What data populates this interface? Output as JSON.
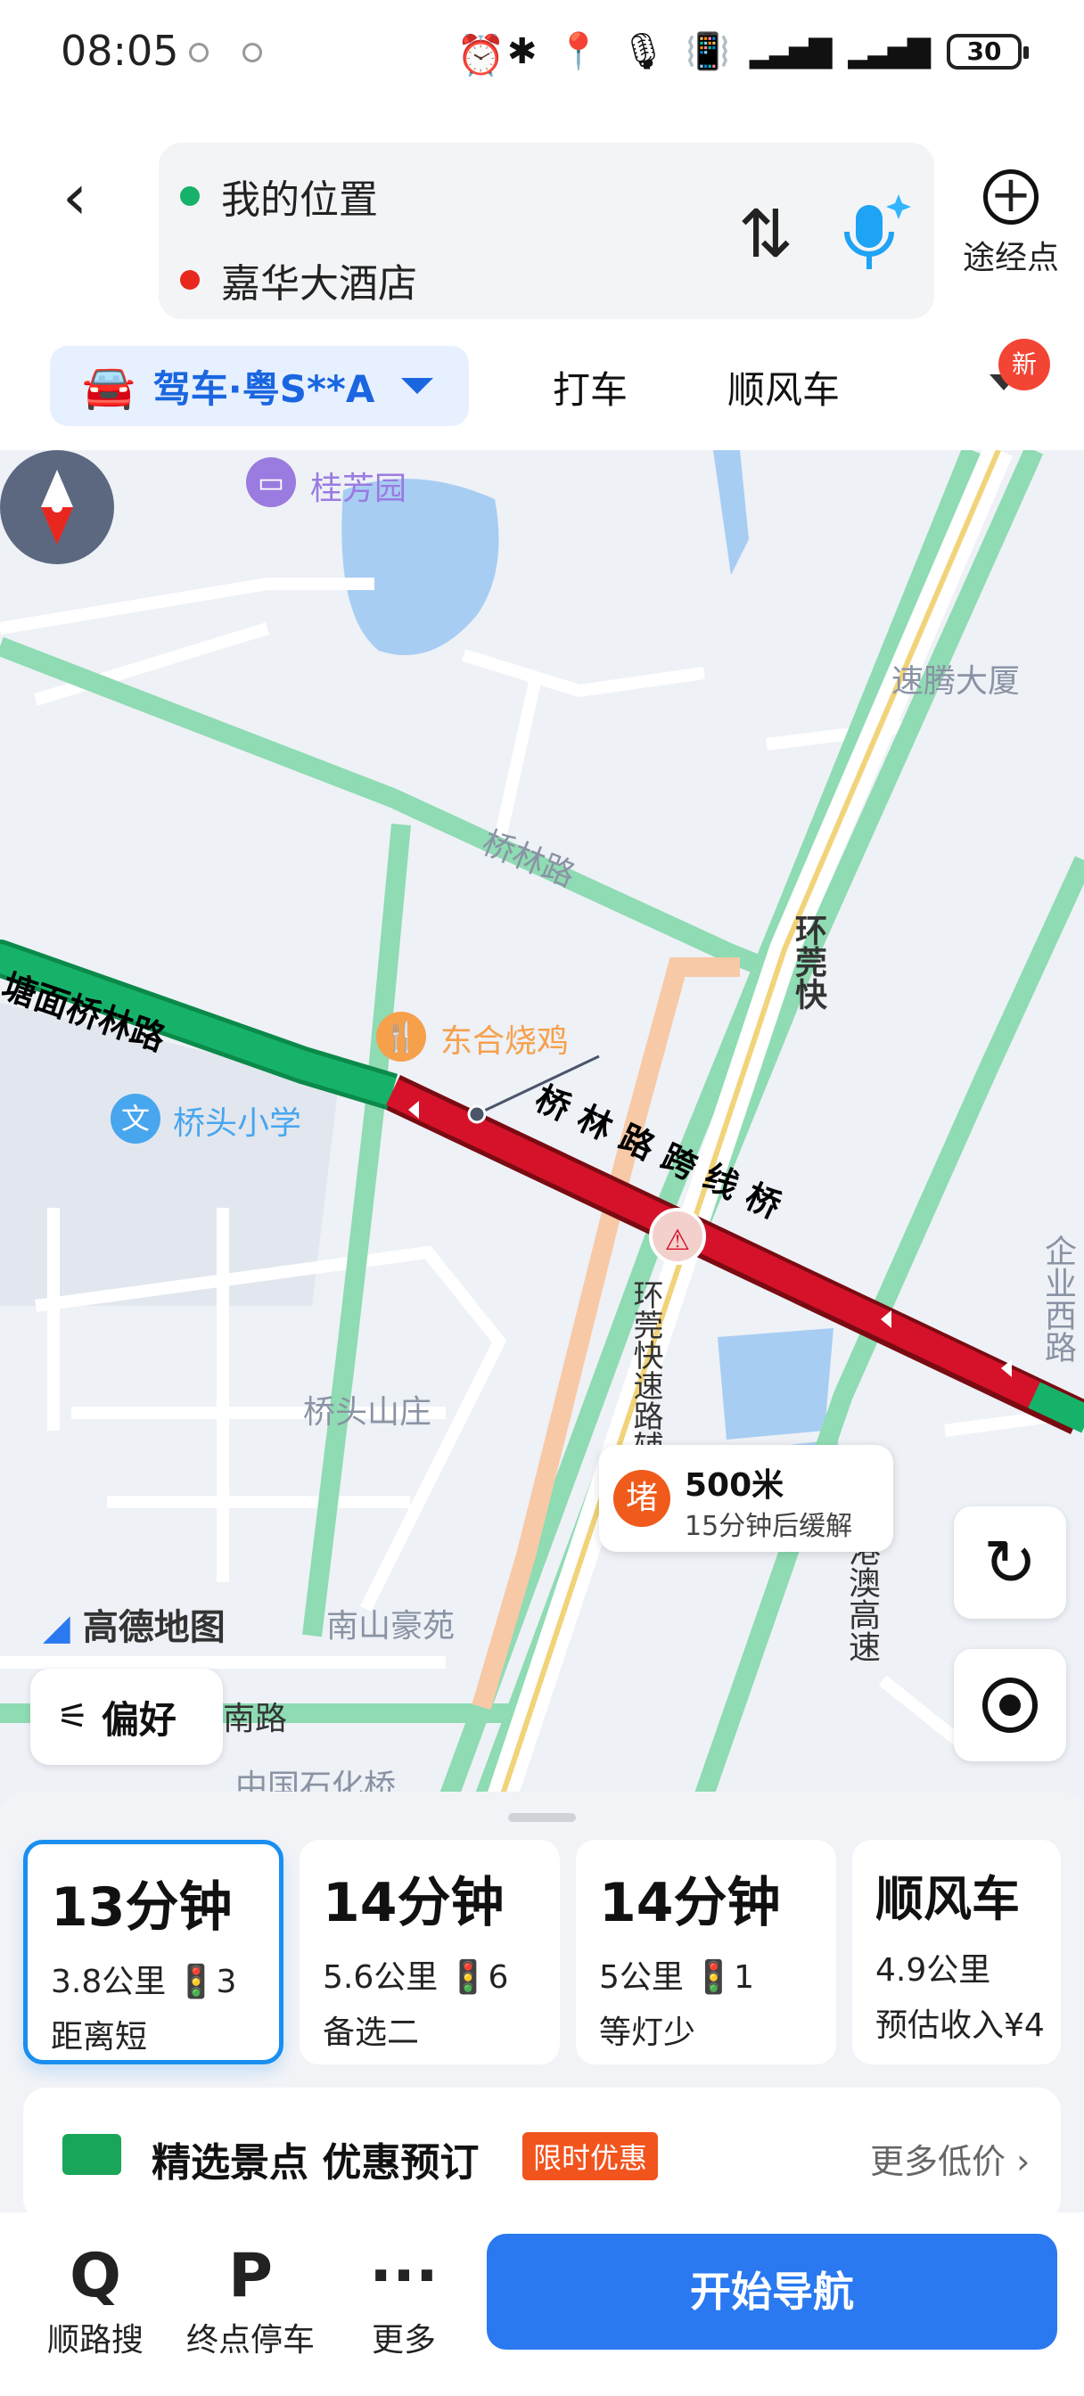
{
  "status_bar": {
    "time": "08:05",
    "battery": "30"
  },
  "route": {
    "origin": "我的位置",
    "destination": "嘉华大酒店",
    "waypoint_label": "途经点"
  },
  "modes": {
    "active": "驾车·粤S**A",
    "tabs": [
      "打车",
      "顺风车"
    ],
    "new_badge": "新"
  },
  "map": {
    "labels": [
      "桂芳园",
      "速腾大厦",
      "桥林路",
      "环莞快",
      "塘面桥林路",
      "东合烧鸡",
      "桥头小学",
      "桥林路跨线桥",
      "环莞快速路辅路",
      "桥头山庄",
      "京港澳高速",
      "南山豪苑",
      "南路",
      "中国石化桥",
      "企业西路"
    ],
    "brand": "高德地图",
    "traffic": {
      "icon": "堵",
      "distance": "500米",
      "note": "15分钟后缓解"
    },
    "preference_label": "偏好"
  },
  "options": [
    {
      "time": "13分钟",
      "detail": "3.8公里 🚦3",
      "tag": "距离短",
      "selected": true
    },
    {
      "time": "14分钟",
      "detail": "5.6公里 🚦6",
      "tag": "备选二",
      "selected": false
    },
    {
      "time": "14分钟",
      "detail": "5公里 🚦1",
      "tag": "等灯少",
      "selected": false
    },
    {
      "time": "顺风车",
      "detail": "4.9公里",
      "tag": "预估收入¥4",
      "selected": false
    }
  ],
  "promo": {
    "title": "精选景点 优惠预订",
    "tag": "限时优惠",
    "more": "更多低价 ›"
  },
  "bottom_nav": [
    {
      "icon": "Q",
      "label": "顺路搜"
    },
    {
      "icon": "P",
      "label": "终点停车"
    },
    {
      "icon": "···",
      "label": "更多"
    }
  ],
  "start_button": "开始导航",
  "colors": {
    "congestion_red": "#d5122a",
    "smooth_green": "#17b26a",
    "accent_blue": "#2a79f0"
  }
}
